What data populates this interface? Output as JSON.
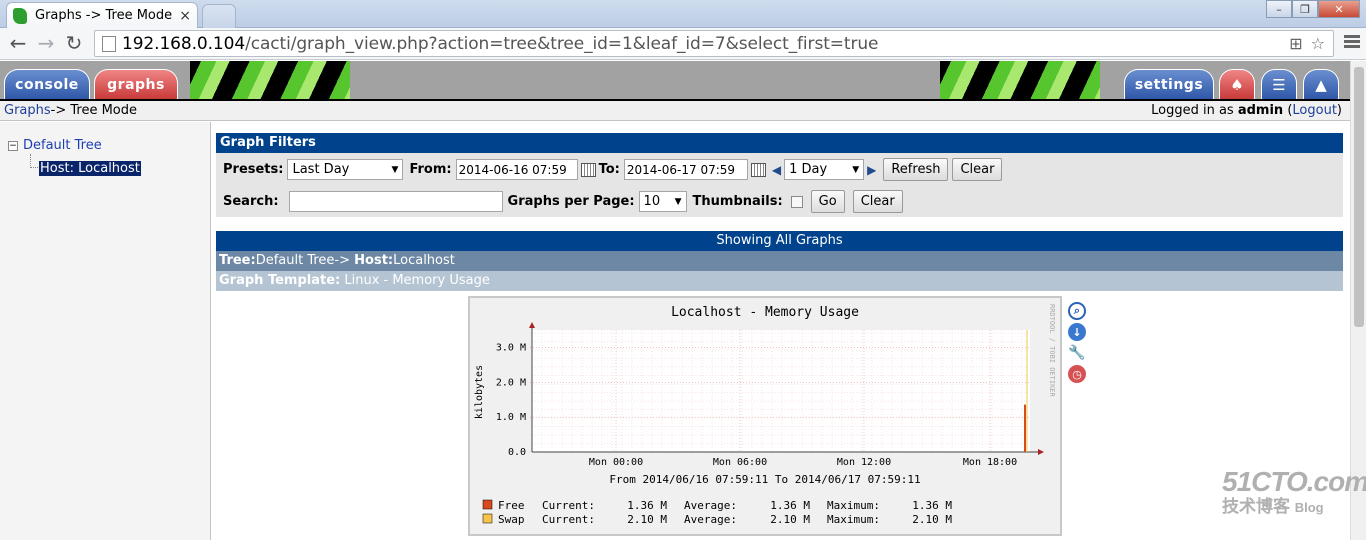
{
  "browser": {
    "tab_title": "Graphs -> Tree Mode",
    "tab_close": "×",
    "url_host": "192.168.0.104",
    "url_path": "/cacti/graph_view.php?action=tree&tree_id=1&leaf_id=7&select_first=true",
    "window_buttons": [
      "–",
      "❐",
      "✕"
    ]
  },
  "header": {
    "console_tab": "console",
    "graphs_tab": "graphs",
    "settings_tab": "settings"
  },
  "breadcrumb": {
    "link": "Graphs",
    "rest": " -> Tree Mode",
    "logged_in_prefix": "Logged in as ",
    "user": "admin",
    "logout": "Logout"
  },
  "tree": {
    "toggle": "−",
    "root": "Default Tree",
    "leaf": "Host: Localhost"
  },
  "filters": {
    "title": "Graph Filters",
    "presets_label": "Presets:",
    "presets_value": "Last Day",
    "from_label": "From:",
    "from_value": "2014-06-16 07:59",
    "to_label": "To:",
    "to_value": "2014-06-17 07:59",
    "timespan_value": "1 Day",
    "refresh_label": "Refresh",
    "clear_label": "Clear",
    "search_label": "Search:",
    "search_value": "",
    "per_page_label": "Graphs per Page:",
    "per_page_value": "10",
    "thumbnails_label": "Thumbnails:",
    "go_label": "Go",
    "clear2_label": "Clear"
  },
  "listing": {
    "showing": "Showing All Graphs",
    "tree_prefix": "Tree:",
    "tree_value": "Default Tree->",
    "host_prefix": "Host:",
    "host_value": "Localhost",
    "template_prefix": "Graph Template:",
    "template_value": "Linux - Memory Usage"
  },
  "chart_data": {
    "type": "line",
    "title": "Localhost - Memory Usage",
    "ylabel": "kilobytes",
    "ylim": [
      0,
      3.5
    ],
    "y_ticks": [
      "0.0",
      "1.0 M",
      "2.0 M",
      "3.0 M"
    ],
    "x_ticks": [
      "Mon 00:00",
      "Mon 06:00",
      "Mon 12:00",
      "Mon 18:00"
    ],
    "range_text": "From 2014/06/16 07:59:11 To 2014/06/17 07:59:11",
    "watermark": "RRDTOOL / TOBI OETIKER",
    "series": [
      {
        "name": "Free",
        "color": "#d64a1e",
        "stats": [
          "Current:",
          "1.36 M",
          "Average:",
          "1.36 M",
          "Maximum:",
          "1.36 M"
        ],
        "last_value": 1.36
      },
      {
        "name": "Swap",
        "color": "#f5c54a",
        "stats": [
          "Current:",
          "2.10 M",
          "Average:",
          "2.10 M",
          "Maximum:",
          "2.10 M"
        ],
        "last_value": 2.1
      }
    ]
  },
  "graph_actions": [
    "zoom-icon",
    "csv-icon",
    "properties-icon",
    "time-shift-icon"
  ],
  "watermark": {
    "big": "51CTO.com",
    "small": "技术博客",
    "blog": "Blog"
  },
  "colors": {
    "header_blue": "#00438c",
    "tree_row": "#6d88a4",
    "template_row": "#b5c4d3"
  }
}
